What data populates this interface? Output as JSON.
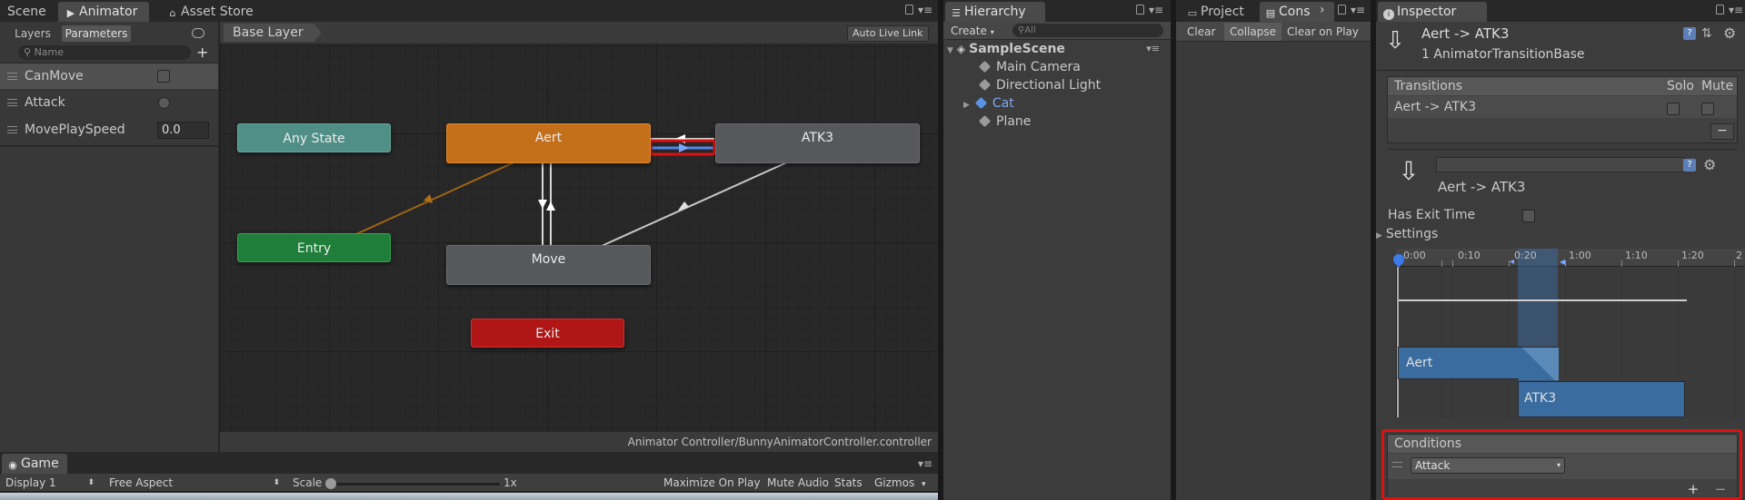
{
  "scene_tabs": {
    "scene": "Scene",
    "animator": "Animator",
    "asset_store": "Asset Store"
  },
  "animator": {
    "sub_tabs": {
      "layers": "Layers",
      "parameters": "Parameters"
    },
    "search_placeholder": "Name",
    "parameters": [
      {
        "name": "CanMove",
        "type": "bool"
      },
      {
        "name": "Attack",
        "type": "trigger"
      },
      {
        "name": "MovePlaySpeed",
        "type": "float",
        "value": "0.0"
      }
    ],
    "breadcrumb": "Base Layer",
    "auto_live_link": "Auto Live Link",
    "nodes": {
      "any_state": "Any State",
      "entry": "Entry",
      "aert": "Aert",
      "atk3": "ATK3",
      "move": "Move",
      "exit": "Exit"
    },
    "footer_path": "Animator Controller/BunnyAnimatorController.controller"
  },
  "game": {
    "tab": "Game",
    "display": "Display 1",
    "aspect": "Free Aspect",
    "scale_label": "Scale",
    "scale_value": "1x",
    "maximize": "Maximize On Play",
    "mute": "Mute Audio",
    "stats": "Stats",
    "gizmos": "Gizmos"
  },
  "hierarchy": {
    "tab": "Hierarchy",
    "create": "Create",
    "search_placeholder": "All",
    "scene": "SampleScene",
    "items": [
      "Main Camera",
      "Directional Light",
      "Cat",
      "Plane"
    ]
  },
  "console": {
    "tabs": {
      "project": "Project",
      "console": "Cons"
    },
    "clear": "Clear",
    "collapse": "Collapse",
    "clear_on_play": "Clear on Play"
  },
  "inspector": {
    "tab": "Inspector",
    "title": "Aert -> ATK3",
    "subtitle": "1 AnimatorTransitionBase",
    "transitions_header": "Transitions",
    "solo": "Solo",
    "mute": "Mute",
    "transition_row": "Aert -> ATK3",
    "minus": "−",
    "name_field": "",
    "transition_name": "Aert -> ATK3",
    "has_exit_time": "Has Exit Time",
    "settings": "Settings",
    "timeline_ticks": [
      "0:00",
      "0:10",
      "0:20",
      "1:00",
      "1:10",
      "1:20",
      "2"
    ],
    "clip_from": "Aert",
    "clip_to": "ATK3",
    "conditions_header": "Conditions",
    "condition_param": "Attack",
    "plus": "+"
  },
  "colors": {
    "any_state": "#4f8f86",
    "entry": "#1f7f3a",
    "aert": "#c4701b",
    "atk3": "#56585b",
    "move": "#56585b",
    "exit": "#b01616",
    "highlight": "#e01010",
    "selected_blue": "#3e7be5"
  }
}
